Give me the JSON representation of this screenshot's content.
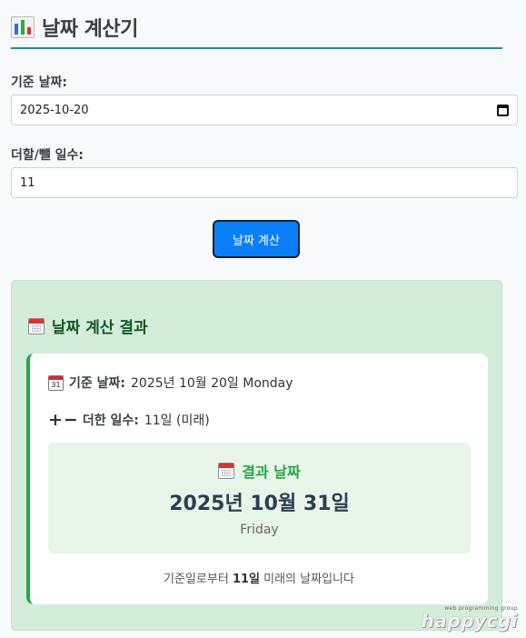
{
  "header": {
    "title": "날짜 계산기",
    "icon": "bar-chart-icon"
  },
  "form": {
    "base_date_label": "기준 날짜:",
    "base_date_value": "2025-10-20",
    "days_label": "더할/뺄 일수:",
    "days_value": "11",
    "calculate_button_label": "날짜 계산"
  },
  "result": {
    "title": "날짜 계산 결과",
    "base_date_label": "기준 날짜:",
    "base_date_value": "2025년 10월 20일 Monday",
    "added_days_label": "더한 일수:",
    "added_days_value": "11일 (미래)",
    "result_label": "결과 날짜",
    "result_date": "2025년 10월 31일",
    "result_weekday": "Friday",
    "note_prefix": "기준일로부터 ",
    "note_days": "11일",
    "note_suffix": " 미래의 날짜입니다",
    "date_icon_number": "31"
  },
  "watermark": {
    "small": "web programming group",
    "big": "happycgi"
  },
  "colors": {
    "accent_blue": "#0b7ff7",
    "title_underline": "#1a8ab5",
    "result_panel_bg": "#d4edda",
    "result_green": "#28a745",
    "result_dark_green": "#155724"
  }
}
